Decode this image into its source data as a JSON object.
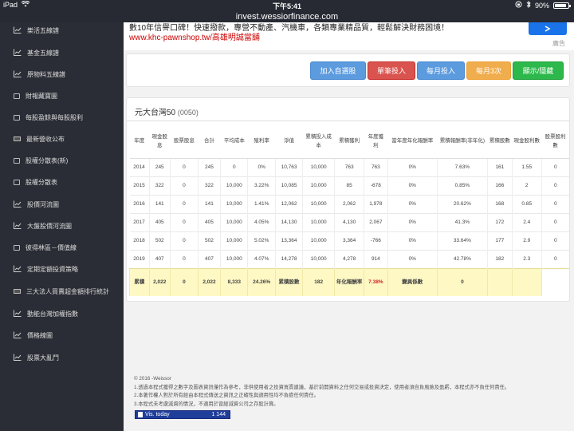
{
  "status_bar": {
    "device": "iPad",
    "time": "下午5:41",
    "battery": "90%",
    "battery_level": 0.9
  },
  "url": "invest.wessiorfinance.com",
  "sidebar": {
    "items": [
      {
        "label": "樂活五線譜",
        "icon": "chart-line-icon"
      },
      {
        "label": "基金五線譜",
        "icon": "chart-line-icon"
      },
      {
        "label": "原物料五線譜",
        "icon": "chart-line-icon"
      },
      {
        "label": "財報藏寶圖",
        "icon": "square-icon"
      },
      {
        "label": "每股盈餘與每股股利",
        "icon": "square-icon"
      },
      {
        "label": "最新營收公布",
        "icon": "card-icon"
      },
      {
        "label": "股權分散表(新)",
        "icon": "square-icon"
      },
      {
        "label": "股權分散表",
        "icon": "square-icon"
      },
      {
        "label": "股價河流圖",
        "icon": "chart-line-icon"
      },
      {
        "label": "大盤股價河流圖",
        "icon": "chart-line-icon"
      },
      {
        "label": "彼得林區－價值線",
        "icon": "square-icon"
      },
      {
        "label": "定期定額投資策略",
        "icon": "chart-line-icon"
      },
      {
        "label": "三大法人買賣超金額排行統計",
        "icon": "card-icon"
      },
      {
        "label": "動能台灣加權指數",
        "icon": "chart-line-icon"
      },
      {
        "label": "價格線圖",
        "icon": "chart-line-icon"
      },
      {
        "label": "股票大亂鬥",
        "icon": "chart-line-icon"
      }
    ]
  },
  "ad": {
    "line1": "數10年信譽口碑！快速撥款，專營不動產、汽機車，各類專業精品質，輕鬆解決財務困境！",
    "link": "www.khc-pawnshop.tw/高雄明誠當舖",
    "button_icon": "arrow-right-icon",
    "label": "廣告"
  },
  "buttons": {
    "add_watchlist": "加入自選股",
    "single_invest": "單筆投入",
    "monthly_invest": "每月投入",
    "monthly_3x": "每月3次",
    "toggle_display": "顯示/隱藏"
  },
  "table": {
    "title": "元大台灣50",
    "code": "(0050)",
    "headers": [
      "年度",
      "現金股息",
      "股票股息",
      "合計",
      "平均成本",
      "殖利率",
      "淨值",
      "累積投入成本",
      "累積獲利",
      "年度獲利",
      "當年度年化報酬率",
      "累積報酬率(非年化)",
      "累積股數",
      "現金股利數",
      "股票股利數"
    ],
    "rows": [
      [
        "2014",
        "245",
        "0",
        "245",
        "0",
        "0%",
        "10,763",
        "10,000",
        "763",
        "763",
        "0%",
        "7.63%",
        "161",
        "1.55",
        "0"
      ],
      [
        "2015",
        "322",
        "0",
        "322",
        "10,000",
        "3.22%",
        "10,085",
        "10,000",
        "85",
        "-678",
        "0%",
        "0.85%",
        "166",
        "2",
        "0"
      ],
      [
        "2016",
        "141",
        "0",
        "141",
        "10,000",
        "1.41%",
        "12,062",
        "10,000",
        "2,062",
        "1,978",
        "0%",
        "20.62%",
        "168",
        "0.85",
        "0"
      ],
      [
        "2017",
        "405",
        "0",
        "405",
        "10,000",
        "4.05%",
        "14,130",
        "10,000",
        "4,130",
        "2,067",
        "0%",
        "41.3%",
        "172",
        "2.4",
        "0"
      ],
      [
        "2018",
        "502",
        "0",
        "502",
        "10,000",
        "5.02%",
        "13,364",
        "10,000",
        "3,364",
        "-766",
        "0%",
        "33.64%",
        "177",
        "2.9",
        "0"
      ],
      [
        "2019",
        "407",
        "0",
        "407",
        "10,000",
        "4.07%",
        "14,278",
        "10,000",
        "4,278",
        "914",
        "0%",
        "42.78%",
        "182",
        "2.3",
        "0"
      ]
    ],
    "total": {
      "label": "累積",
      "cash_div": "2,022",
      "stock_div": "0",
      "sum": "2,022",
      "avg_cost": "8,333",
      "yield": "24.26%",
      "shares_label": "累積股數",
      "shares": "182",
      "annual_label": "年化報酬率",
      "annual_value": "7.38%",
      "volatility_label": "變異係數",
      "volatility_value": "0"
    }
  },
  "footer": {
    "copyright": "© 2016 -Weissor",
    "notes": [
      "1.透過本程式獲得之數字及圖表資訊僅作為參考，非供使用者之投資買賣建議，基於前開資料之任何交易或投資決定，使用者須自負風險及盈虧，本程式亦不負任何責任。",
      "2.本著作權人對於所有經由本程式傳送之資訊之正確性與適用性均不負擔任何責任。",
      "3.本程式未考慮減資的情況，不適用於曾經減資公司之存股計算。"
    ],
    "vis_label": "Vis. today",
    "vis_count": "1 144"
  }
}
